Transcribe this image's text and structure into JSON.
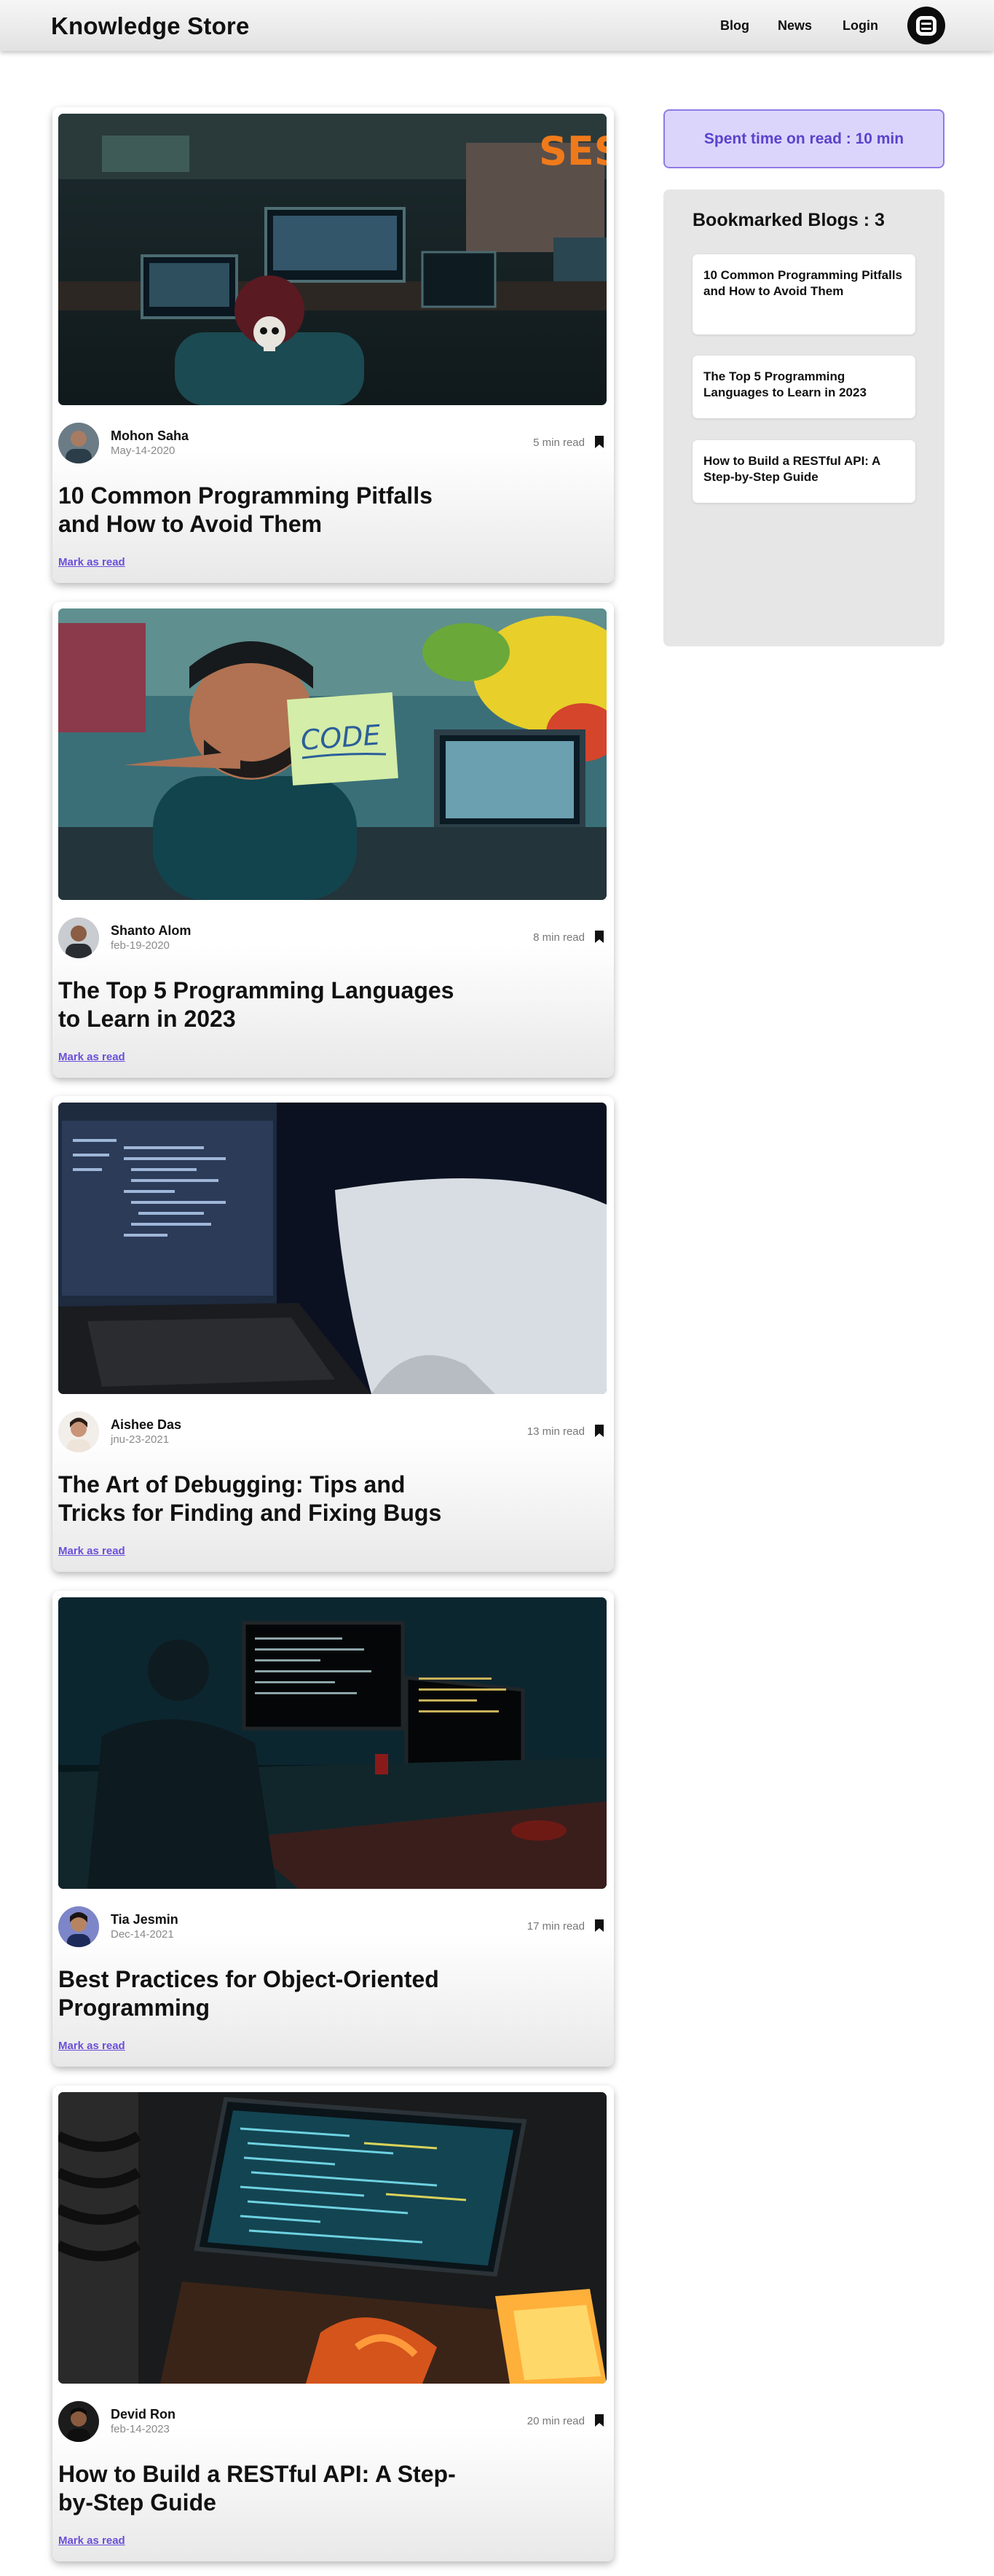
{
  "header": {
    "brand": "Knowledge Store",
    "nav": [
      "Blog",
      "News",
      "Login"
    ],
    "logo_icon": "blogger-logo-icon"
  },
  "blogs": [
    {
      "author": "Mohon Saha",
      "date": "May-14-2020",
      "read_time": "5 min read",
      "title": "10 Common Programming Pitfalls and How to Avoid Them",
      "mark_label": "Mark as read",
      "cover_icon": "office-desk-hacker-photo"
    },
    {
      "author": "Shanto Alom",
      "date": "feb-19-2020",
      "read_time": "8 min read",
      "title": "The Top 5 Programming Languages to Learn in 2023",
      "mark_label": "Mark as read",
      "cover_icon": "man-holding-code-note-photo",
      "cover_note": "CODE"
    },
    {
      "author": "Aishee Das",
      "date": "jnu-23-2021",
      "read_time": "13 min read",
      "title": "The Art of Debugging: Tips and Tricks for Finding and Fixing Bugs",
      "mark_label": "Mark as read",
      "cover_icon": "laptop-code-dark-photo"
    },
    {
      "author": "Tia Jesmin",
      "date": "Dec-14-2021",
      "read_time": "17 min read",
      "title": "Best Practices for Object-Oriented Programming",
      "mark_label": "Mark as read",
      "cover_icon": "developer-dual-monitor-photo"
    },
    {
      "author": "Devid Ron",
      "date": "feb-14-2023",
      "read_time": "20 min read",
      "title": "How to Build a RESTful API: A Step-by-Step Guide",
      "mark_label": "Mark as read",
      "cover_icon": "laptop-orange-light-photo"
    }
  ],
  "sidebar": {
    "spent_time": "Spent time on read : 10 min",
    "bookmark_heading": "Bookmarked Blogs : 3",
    "bookmarks": [
      "10 Common Programming Pitfalls and How to Avoid Them",
      "The Top 5 Programming Languages to Learn in 2023",
      "How to Build a RESTful API: A Step-by-Step Guide"
    ]
  },
  "colors": {
    "accent": "#6b4fd8",
    "spent_bg": "#dcd5fb",
    "panel_bg": "#e6e6e6"
  }
}
